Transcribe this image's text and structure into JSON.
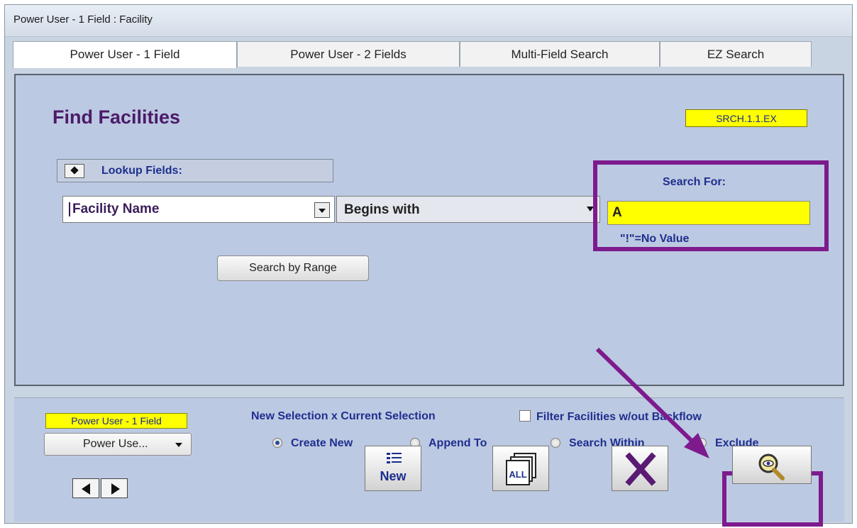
{
  "window": {
    "title": "Power User - 1 Field : Facility"
  },
  "tabs": [
    {
      "label": "Power User - 1 Field",
      "active": true
    },
    {
      "label": "Power User - 2 Fields",
      "active": false
    },
    {
      "label": "Multi-Field Search",
      "active": false
    },
    {
      "label": "EZ Search",
      "active": false
    }
  ],
  "main": {
    "heading": "Find Facilities",
    "screen_code": "SRCH.1.1.EX",
    "lookup_label": "Lookup Fields:",
    "field_value": "Facility Name",
    "operator_value": "Begins with",
    "search_label": "Search For:",
    "search_value": "A",
    "no_value_hint": "\"!\"=No Value",
    "range_button": "Search by Range"
  },
  "bottom": {
    "mode_badge": "Power User - 1 Field",
    "mode_select": "Power Use...",
    "selection_heading": "New Selection x Current Selection",
    "filter_label": "Filter Facilities w/out Backflow",
    "filter_checked": false,
    "radios": [
      {
        "label": "Create New",
        "selected": true
      },
      {
        "label": "Append To",
        "selected": false
      },
      {
        "label": "Search Within",
        "selected": false
      },
      {
        "label": "Exclude",
        "selected": false
      }
    ],
    "new_button": "New",
    "all_button": "ALL"
  },
  "icons": {
    "lookup_toggle": "diamond-toggle-icon",
    "new": "list-new-icon",
    "all": "stacked-files-all-icon",
    "close": "x-icon",
    "execute": "magnifier-eye-icon",
    "prev": "triangle-left-icon",
    "next": "triangle-right-icon"
  },
  "colors": {
    "highlight_frame": "#7d1b8d",
    "badge_yellow": "#ffff00",
    "label_blue": "#1f2f8f",
    "heading_purple": "#4b1b68"
  }
}
